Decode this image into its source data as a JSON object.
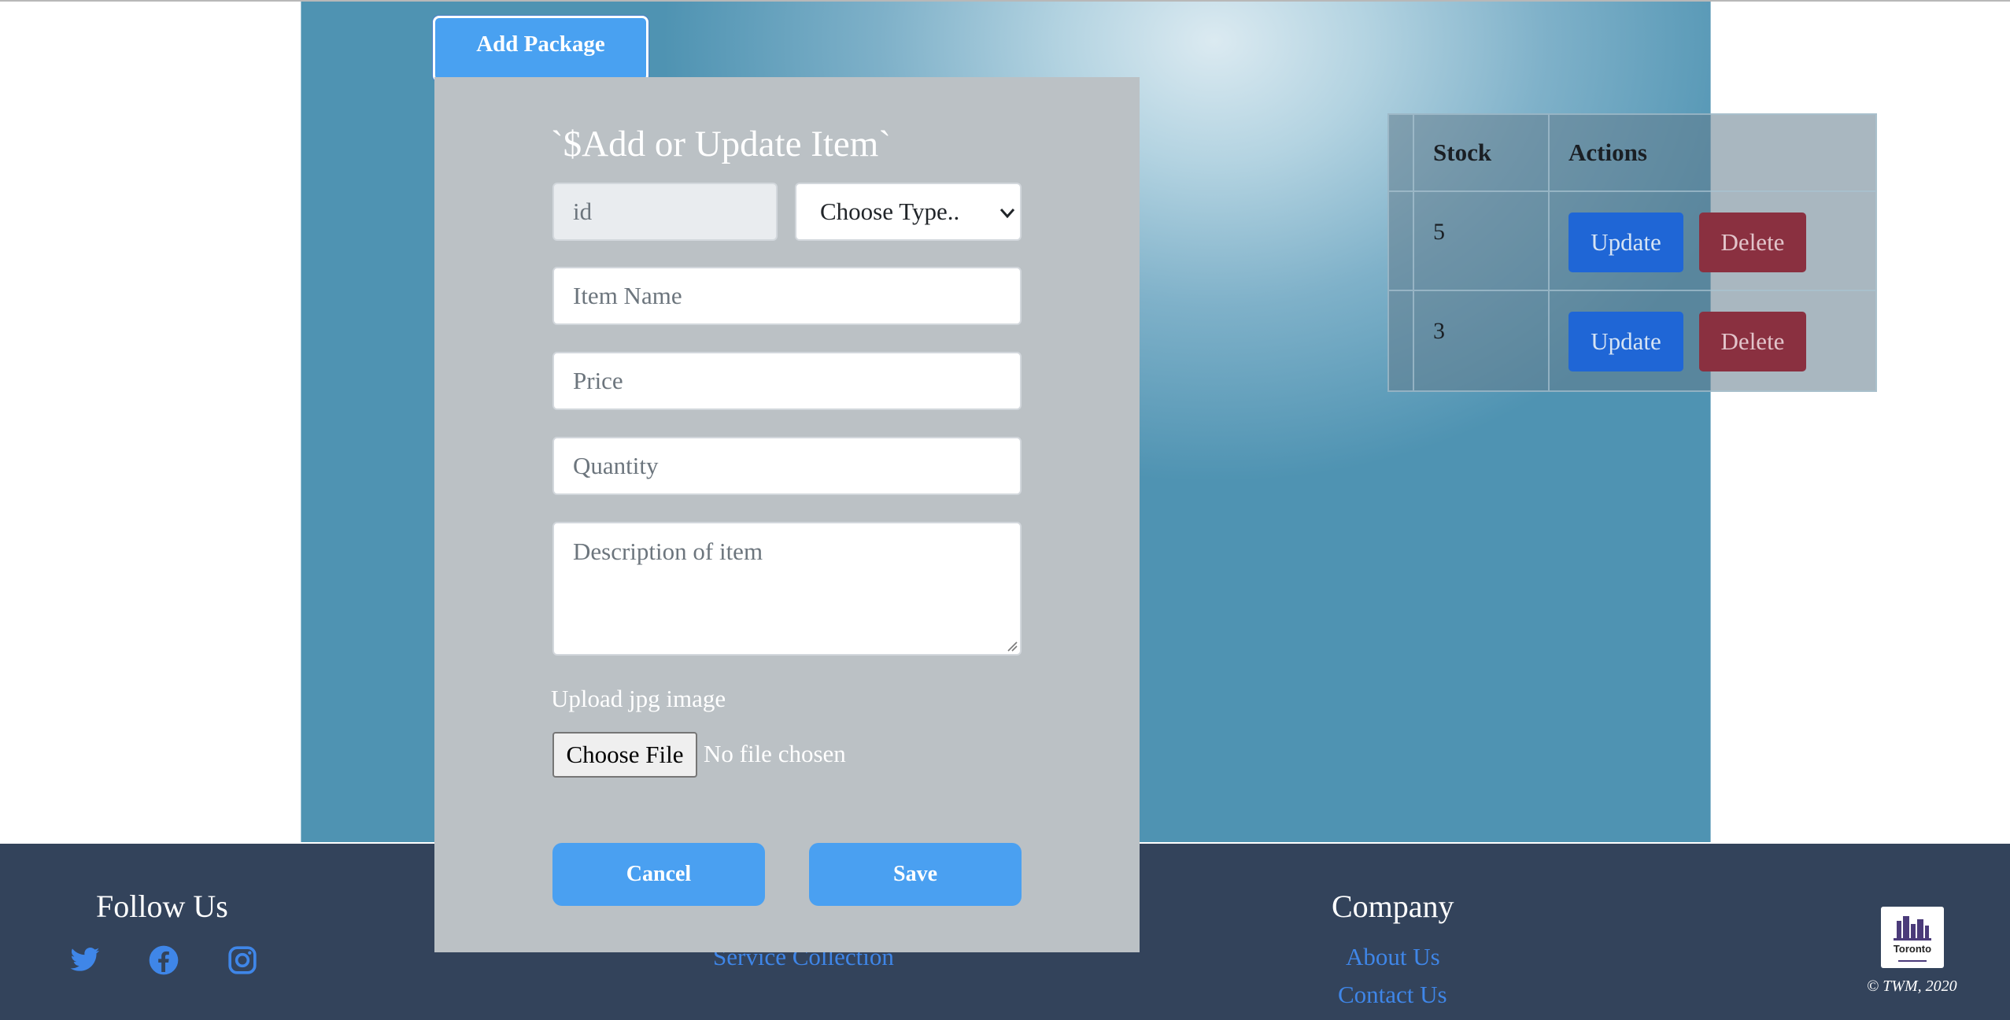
{
  "header": {
    "add_package_label": "Add Package"
  },
  "table": {
    "headers": {
      "stock": "Stock",
      "actions": "Actions"
    },
    "rows": [
      {
        "stock": "5",
        "update_label": "Update",
        "delete_label": "Delete"
      },
      {
        "stock": "3",
        "update_label": "Update",
        "delete_label": "Delete"
      }
    ]
  },
  "modal": {
    "title": "`$Add or Update Item`",
    "id_placeholder": "id",
    "type_select": {
      "selected": "Choose Type.."
    },
    "item_name_placeholder": "Item Name",
    "price_placeholder": "Price",
    "quantity_placeholder": "Quantity",
    "description_placeholder": "Description of item",
    "upload_label": "Upload jpg image",
    "file_button_label": "Choose File",
    "file_status": "No file chosen",
    "cancel_label": "Cancel",
    "save_label": "Save"
  },
  "footer": {
    "follow_title": "Follow Us",
    "social_icons": [
      "twitter-icon",
      "facebook-icon",
      "instagram-icon"
    ],
    "service_link": "Service Collection",
    "company_title": "Company",
    "company_links": [
      "About Us",
      "Contact Us"
    ],
    "logo_text": "Toronto",
    "copyright": "© TWM, 2020"
  },
  "colors": {
    "primary_button": "#4aa0f1",
    "update_button": "#1f66d6",
    "delete_button": "#8a3040",
    "footer_bg": "#33435b",
    "footer_link": "#3f86e8",
    "modal_bg": "#bbc1c5"
  }
}
